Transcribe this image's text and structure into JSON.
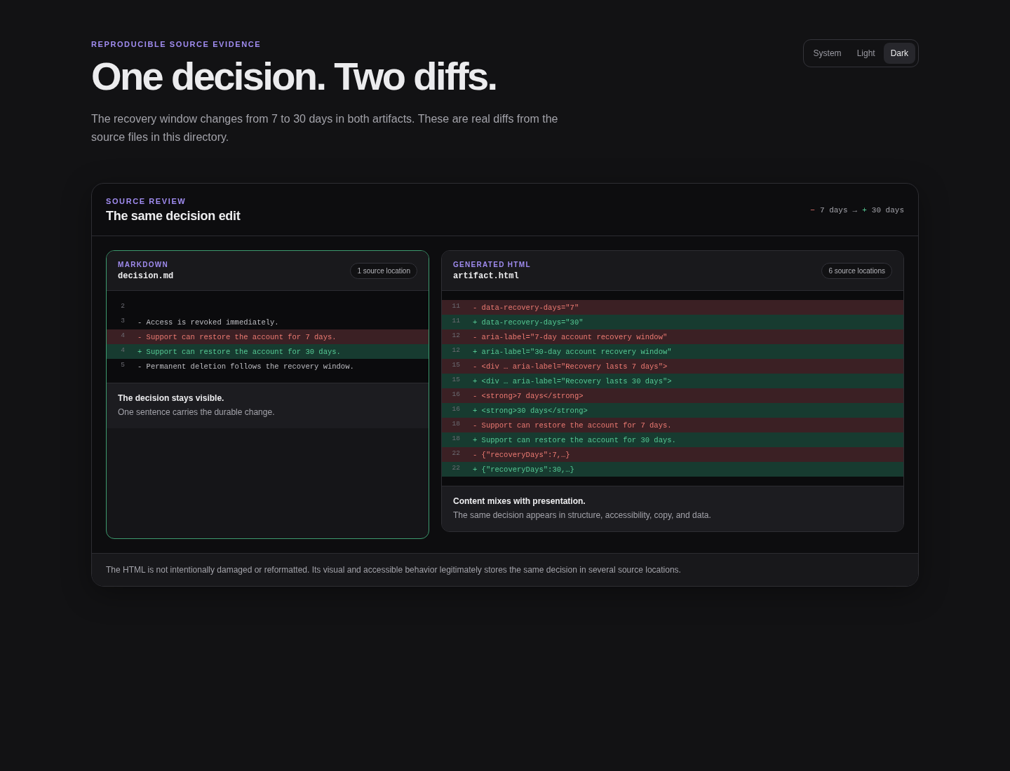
{
  "eyebrow": "REPRODUCIBLE SOURCE EVIDENCE",
  "title": "One decision. Two diffs.",
  "subtitle": "The recovery window changes from 7 to 30 days in both artifacts. These are real diffs from the source files in this directory.",
  "theme_switch": [
    {
      "label": "System",
      "selected": false
    },
    {
      "label": "Light",
      "selected": false
    },
    {
      "label": "Dark",
      "selected": true
    }
  ],
  "review": {
    "eyebrow": "SOURCE REVIEW",
    "title": "The same decision edit",
    "legend": {
      "removed_sign": "−",
      "removed": "7 days",
      "arrow": "→",
      "added_sign": "+",
      "added": "30 days"
    },
    "panels": [
      {
        "eyebrow": "MARKDOWN",
        "file": "decision.md",
        "badge": "1 source location",
        "highlighted": true,
        "lines": [
          {
            "number": "2",
            "kind": "context"
          },
          {
            "number": "3",
            "kind": "context",
            "text": "- Access is revoked immediately."
          },
          {
            "number": "4",
            "kind": "removed",
            "text": "- Support can restore the account for 7 days."
          },
          {
            "number": "4",
            "kind": "added",
            "text": "+ Support can restore the account for 30 days."
          },
          {
            "number": "5",
            "kind": "context",
            "text": "- Permanent deletion follows the recovery window."
          }
        ],
        "note_title": "The decision stays visible.",
        "note_text": "One sentence carries the durable change."
      },
      {
        "eyebrow": "GENERATED HTML",
        "file": "artifact.html",
        "badge": "6 source locations",
        "highlighted": false,
        "lines": [
          {
            "number": "11",
            "kind": "removed",
            "text": "- data-recovery-days=\"7\""
          },
          {
            "number": "11",
            "kind": "added",
            "text": "+ data-recovery-days=\"30\""
          },
          {
            "number": "12",
            "kind": "removed",
            "text": "- aria-label=\"7-day account recovery window\""
          },
          {
            "number": "12",
            "kind": "added",
            "text": "+ aria-label=\"30-day account recovery window\""
          },
          {
            "number": "15",
            "kind": "removed",
            "text": "- <div … aria-label=\"Recovery lasts 7 days\">"
          },
          {
            "number": "15",
            "kind": "added",
            "text": "+ <div … aria-label=\"Recovery lasts 30 days\">"
          },
          {
            "number": "16",
            "kind": "removed",
            "text": "- <strong>7 days</strong>"
          },
          {
            "number": "16",
            "kind": "added",
            "text": "+ <strong>30 days</strong>"
          },
          {
            "number": "18",
            "kind": "removed",
            "text": "- Support can restore the account for 7 days."
          },
          {
            "number": "18",
            "kind": "added",
            "text": "+ Support can restore the account for 30 days."
          },
          {
            "number": "22",
            "kind": "removed",
            "text": "- {\"recoveryDays\":7,…}"
          },
          {
            "number": "22",
            "kind": "added",
            "text": "+ {\"recoveryDays\":30,…}"
          }
        ],
        "note_title": "Content mixes with presentation.",
        "note_text": "The same decision appears in structure, accessibility, copy, and data."
      }
    ],
    "footer": "The HTML is not intentionally damaged or reformatted. Its visual and accessible behavior legitimately stores the same decision in several source locations."
  }
}
